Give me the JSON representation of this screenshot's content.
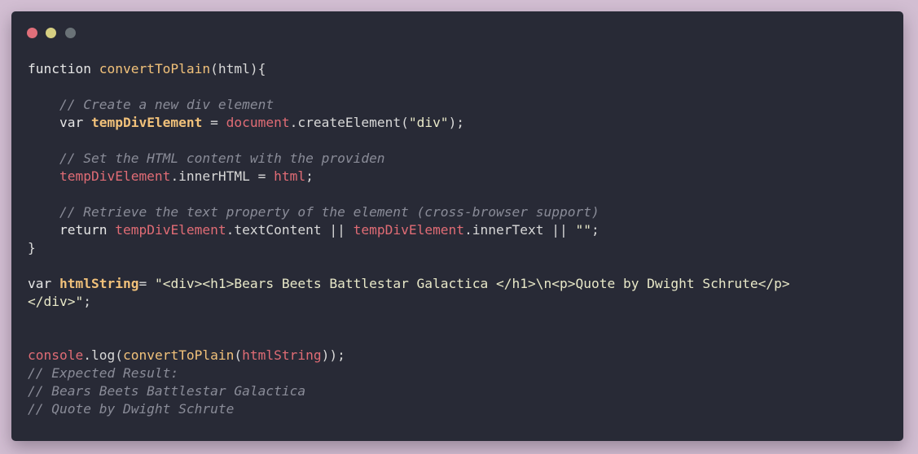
{
  "window": {
    "controls": [
      {
        "name": "close",
        "color": "#e06f7a"
      },
      {
        "name": "minimize",
        "color": "#d6cf82"
      },
      {
        "name": "maximize",
        "color": "#6a7277"
      }
    ]
  },
  "code": {
    "language": "javascript",
    "lines": [
      [
        {
          "t": "kw",
          "v": "function "
        },
        {
          "t": "fn",
          "v": "convertToPlain"
        },
        {
          "t": "plain",
          "v": "(html){"
        }
      ],
      [],
      [
        {
          "t": "plain",
          "v": "    "
        },
        {
          "t": "cm",
          "v": "// Create a new div element"
        }
      ],
      [
        {
          "t": "plain",
          "v": "    "
        },
        {
          "t": "kw",
          "v": "var "
        },
        {
          "t": "var",
          "v": "tempDivElement"
        },
        {
          "t": "plain",
          "v": " = "
        },
        {
          "t": "ident",
          "v": "document"
        },
        {
          "t": "plain",
          "v": ".createElement("
        },
        {
          "t": "str",
          "v": "\"div\""
        },
        {
          "t": "plain",
          "v": ");"
        }
      ],
      [],
      [
        {
          "t": "plain",
          "v": "    "
        },
        {
          "t": "cm",
          "v": "// Set the HTML content with the providen"
        }
      ],
      [
        {
          "t": "plain",
          "v": "    "
        },
        {
          "t": "ident",
          "v": "tempDivElement"
        },
        {
          "t": "plain",
          "v": ".innerHTML = "
        },
        {
          "t": "ident",
          "v": "html"
        },
        {
          "t": "plain",
          "v": ";"
        }
      ],
      [],
      [
        {
          "t": "plain",
          "v": "    "
        },
        {
          "t": "cm",
          "v": "// Retrieve the text property of the element (cross-browser support)"
        }
      ],
      [
        {
          "t": "plain",
          "v": "    "
        },
        {
          "t": "kw",
          "v": "return "
        },
        {
          "t": "ident",
          "v": "tempDivElement"
        },
        {
          "t": "plain",
          "v": ".textContent || "
        },
        {
          "t": "ident",
          "v": "tempDivElement"
        },
        {
          "t": "plain",
          "v": ".innerText || "
        },
        {
          "t": "str",
          "v": "\"\""
        },
        {
          "t": "plain",
          "v": ";"
        }
      ],
      [
        {
          "t": "plain",
          "v": "}"
        }
      ],
      [],
      [
        {
          "t": "kw",
          "v": "var "
        },
        {
          "t": "var",
          "v": "htmlString"
        },
        {
          "t": "plain",
          "v": "= "
        },
        {
          "t": "str",
          "v": "\"<div><h1>Bears Beets Battlestar Galactica </h1>\\n<p>Quote by Dwight Schrute</p>"
        }
      ],
      [
        {
          "t": "str",
          "v": "</div>\""
        },
        {
          "t": "plain",
          "v": ";"
        }
      ],
      [],
      [],
      [
        {
          "t": "ident",
          "v": "console"
        },
        {
          "t": "plain",
          "v": ".log("
        },
        {
          "t": "fn",
          "v": "convertToPlain"
        },
        {
          "t": "plain",
          "v": "("
        },
        {
          "t": "ident",
          "v": "htmlString"
        },
        {
          "t": "plain",
          "v": "));"
        }
      ],
      [
        {
          "t": "cm",
          "v": "// Expected Result:"
        }
      ],
      [
        {
          "t": "cm",
          "v": "// Bears Beets Battlestar Galactica"
        }
      ],
      [
        {
          "t": "cm",
          "v": "// Quote by Dwight Schrute"
        }
      ]
    ]
  }
}
